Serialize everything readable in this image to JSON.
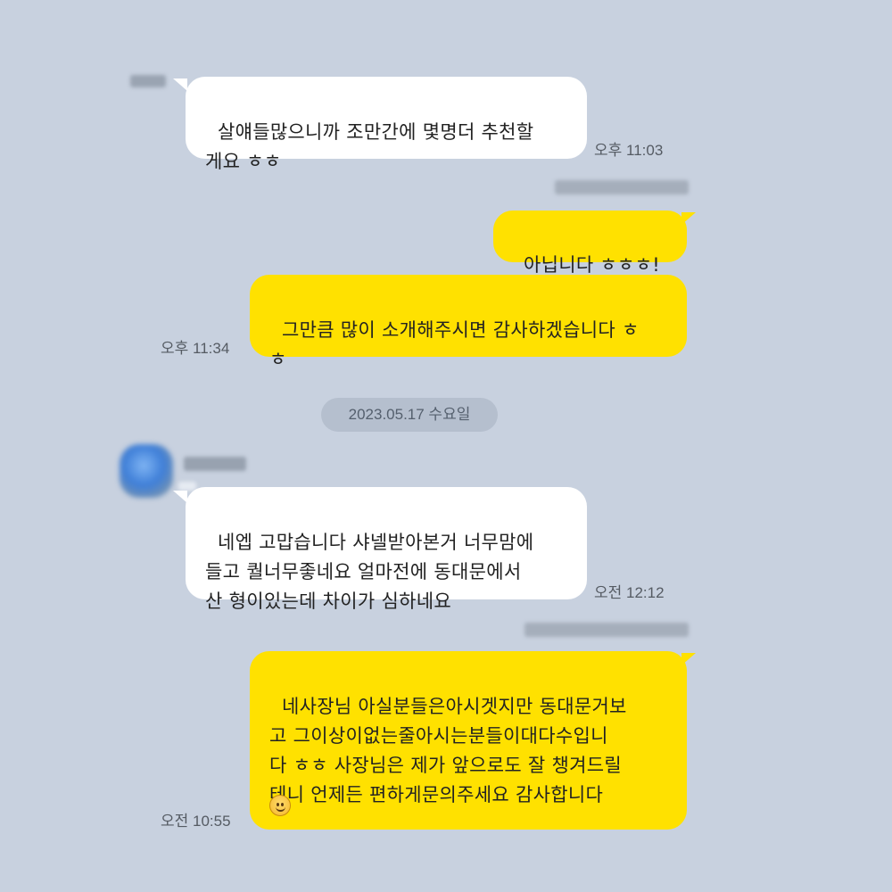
{
  "chat": {
    "date_separator": "2023.05.17 수요일",
    "messages": [
      {
        "text": "살얘들많으니까 조만간에 몇명더 추천할\n게요 ㅎㅎ",
        "time": "오후 11:03"
      },
      {
        "text": "아닙니다 ㅎㅎㅎ!",
        "time": ""
      },
      {
        "text": "그만큼 많이 소개해주시면 감사하겠습니다 ㅎ\nㅎ",
        "time": "오후 11:34"
      },
      {
        "text": "네엡 고맙습니다 샤넬받아본거 너무맘에\n들고 퀄너무좋네요 얼마전에 동대문에서\n산 형이있는데 차이가 심하네요",
        "time": "오전 12:12"
      },
      {
        "text": "네사장님 아실분들은아시겟지만 동대문거보\n고 그이상이없는줄아시는분들이대다수입니\n다 ㅎㅎ 사장님은 제가 앞으로도 잘 챙겨드릴\n테니 언제든 편하게문의주세요 감사합니다",
        "time": "오전 10:55",
        "emoji": "smiling-face"
      }
    ]
  },
  "colors": {
    "background": "#c8d1df",
    "incoming_bubble": "#ffffff",
    "outgoing_bubble": "#ffe100",
    "date_pill": "#b5bfce"
  }
}
